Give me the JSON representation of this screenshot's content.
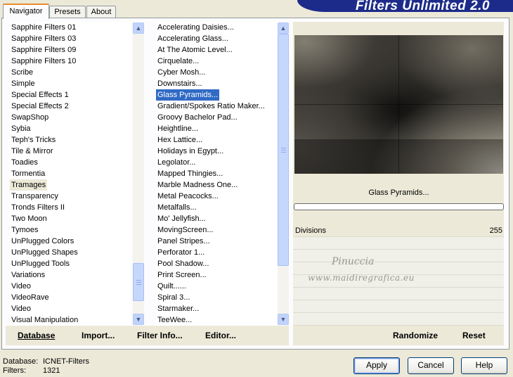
{
  "tabs": [
    "Navigator",
    "Presets",
    "About"
  ],
  "banner": "Filters Unlimited 2.0",
  "categories": [
    "Sapphire Filters 01",
    "Sapphire Filters 03",
    "Sapphire Filters 09",
    "Sapphire Filters 10",
    "Scribe",
    "Simple",
    "Special Effects 1",
    "Special Effects 2",
    "SwapShop",
    "Sybia",
    "Teph's Tricks",
    "Tile & Mirror",
    "Toadies",
    "Tormentia",
    "Tramages",
    "Transparency",
    "Tronds Filters II",
    "Two Moon",
    "Tymoes",
    "UnPlugged Colors",
    "UnPlugged Shapes",
    "UnPlugged Tools",
    "Variations",
    "Video",
    "VideoRave",
    "Video",
    "Visual Manipulation"
  ],
  "selected_category": "Tramages",
  "filters": [
    "Accelerating Daisies...",
    "Accelerating Glass...",
    "At The Atomic Level...",
    "Cirquelate...",
    "Cyber Mosh...",
    "Downstairs...",
    "Glass Pyramids...",
    "Gradient/Spokes Ratio Maker...",
    "Groovy Bachelor Pad...",
    "Heightline...",
    "Hex Lattice...",
    "Holidays in Egypt...",
    "Legolator...",
    "Mapped Thingies...",
    "Marble Madness One...",
    "Metal Peacocks...",
    "Metalfalls...",
    "Mo' Jellyfish...",
    "MovingScreen...",
    "Panel Stripes...",
    "Perforator 1...",
    "Pool Shadow...",
    "Print Screen...",
    "Quilt......",
    "Spiral 3...",
    "Starmaker...",
    "TeeWee..."
  ],
  "selected_filter": "Glass Pyramids...",
  "left_buttons": {
    "database": "Database",
    "import": "Import...",
    "filter_info": "Filter Info...",
    "editor": "Editor..."
  },
  "preview": {
    "filter_name": "Glass Pyramids...",
    "param_label": "Divisions",
    "param_value": "255",
    "watermark_line1": "Pinuccia",
    "watermark_line2": "www.maidiregrafica.eu"
  },
  "right_buttons": {
    "randomize": "Randomize",
    "reset": "Reset"
  },
  "status": {
    "database_label": "Database:",
    "database_value": "ICNET-Filters",
    "filters_label": "Filters:",
    "filters_value": "1321"
  },
  "dialog_buttons": {
    "apply": "Apply",
    "cancel": "Cancel",
    "help": "Help"
  }
}
